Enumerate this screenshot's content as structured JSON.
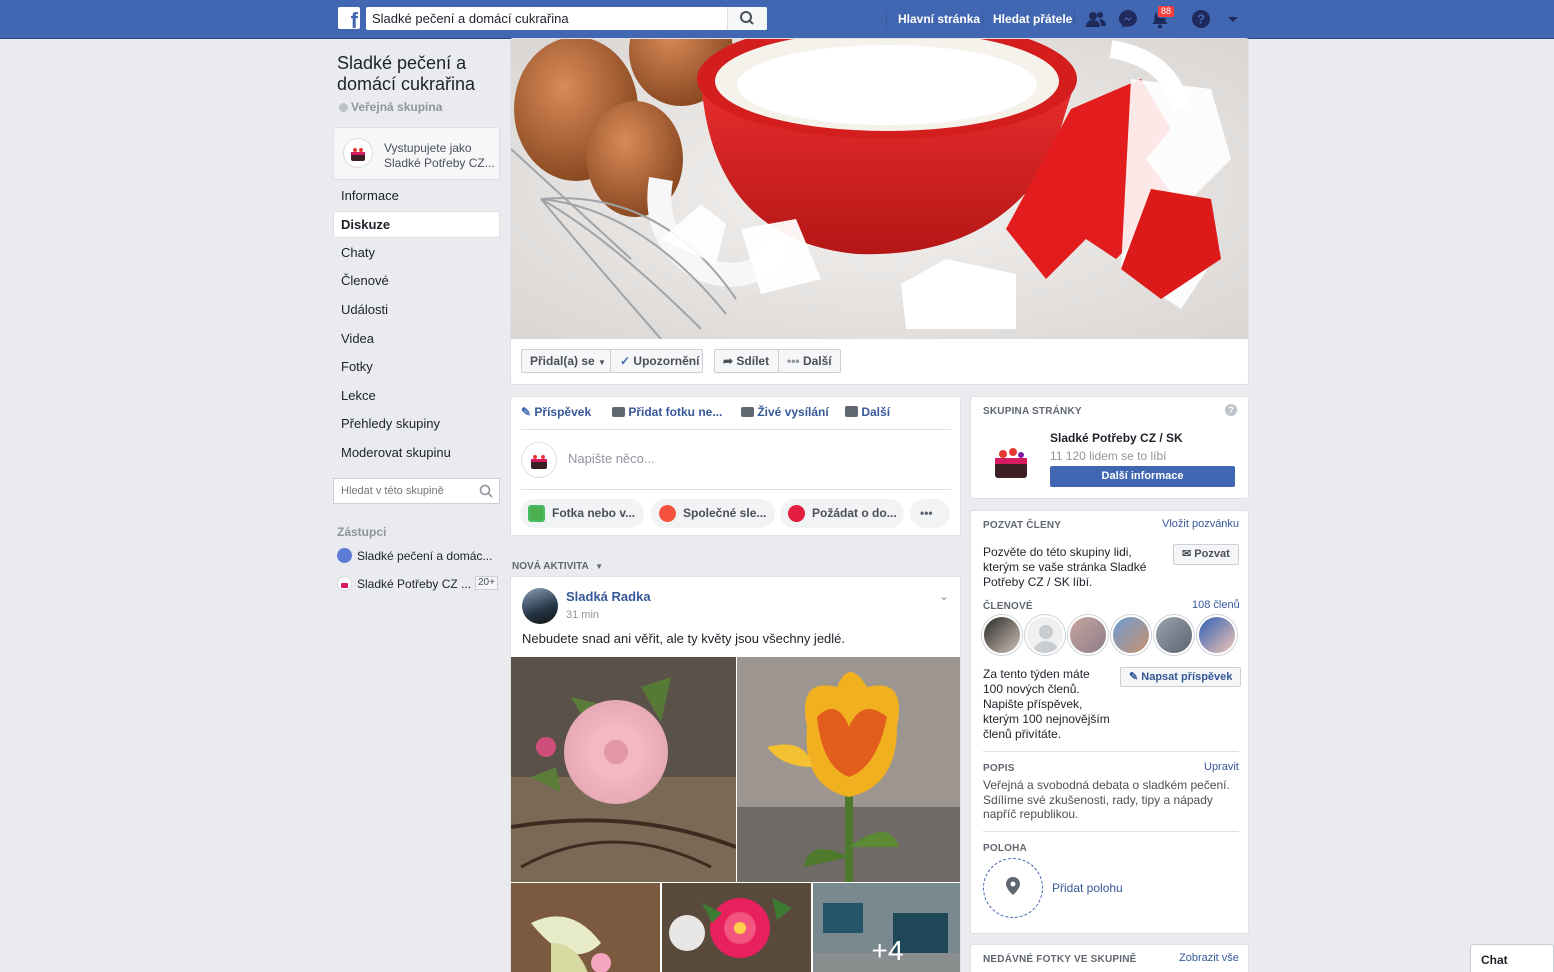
{
  "topbar": {
    "logo": "f",
    "search_value": "Sladké pečení a domácí cukrařina",
    "nav_home": "Hlavní stránka",
    "nav_friends": "Hledat přátele",
    "notif_count": "88",
    "icons": [
      "friends-icon",
      "messenger-icon",
      "bell-icon",
      "help-icon",
      "dropdown-icon"
    ]
  },
  "sidebar": {
    "title": "Sladké pečení a domácí cukrařina",
    "privacy": "Veřejná skupina",
    "acting_as": "Vystupujete jako Sladké Potřeby CZ...",
    "items": [
      "Informace",
      "Diskuze",
      "Chaty",
      "Členové",
      "Události",
      "Videa",
      "Fotky",
      "Lekce",
      "Přehledy skupiny",
      "Moderovat skupinu"
    ],
    "active_index": 1,
    "search_placeholder": "Hledat v této skupině",
    "reps_title": "Zástupci",
    "reps": [
      {
        "name": "Sladké pečení a domác..."
      },
      {
        "name": "Sladké Potřeby CZ ...",
        "badge": "20+"
      }
    ]
  },
  "cover": {
    "joined_btn": "Přidal(a) se",
    "notif_btn": "Upozornění",
    "share_btn": "Sdílet",
    "more_btn": "Další"
  },
  "composer": {
    "tab_post": "Příspěvek",
    "tab_photo": "Přidat fotku ne...",
    "tab_live": "Živé vysílání",
    "tab_more": "Další",
    "placeholder": "Napište něco...",
    "pill_photo": "Fotka nebo v...",
    "pill_watch": "Společné sle...",
    "pill_ask": "Požádat o do...",
    "pill_more": "•••"
  },
  "feed": {
    "section_label": "NOVÁ AKTIVITA",
    "post": {
      "author": "Sladká Radka",
      "time": "31 min",
      "text": "Nebudete snad ani věřit, ale ty květy jsou všechny jedlé.",
      "more_photos": "+4"
    }
  },
  "right": {
    "group_page_title": "SKUPINA STRÁNKY",
    "page_name": "Sladké Potřeby CZ / SK",
    "page_likes": "11 120 lidem se to líbí",
    "page_btn": "Další informace",
    "invite_title": "POZVAT ČLENY",
    "invite_link": "Vložit pozvánku",
    "invite_text": "Pozvěte do této skupiny lidi, kterým se vaše stránka Sladké Potřeby CZ / SK líbí.",
    "invite_btn": "Pozvat",
    "members_title": "ČLENOVÉ",
    "members_count": "108 členů",
    "week_text": "Za tento týden máte 100 nových členů. Napište příspěvek, kterým 100 nejnovějším členů přivítáte.",
    "write_btn": "Napsat příspěvek",
    "desc_title": "POPIS",
    "desc_edit": "Upravit",
    "desc_text": "Veřejná a svobodná debata o sladkém pečení. Sdílíme své zkušenosti, rady, tipy a nápady napříč republikou.",
    "loc_title": "POLOHA",
    "loc_add": "Přidat polohu",
    "photos_title": "NEDÁVNÉ FOTKY VE SKUPINĚ",
    "photos_link": "Zobrazit vše"
  },
  "chat": {
    "label": "Chat"
  },
  "colors": {
    "brand": "#4267b2",
    "link": "#365899",
    "badge": "#fa3e3e"
  }
}
